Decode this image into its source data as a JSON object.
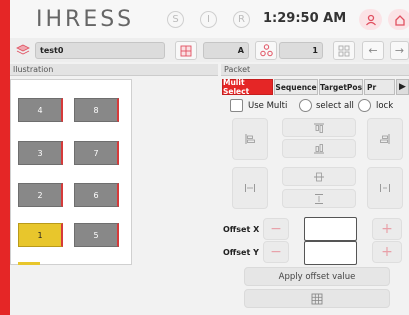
{
  "header": {
    "logo": "IHRESS",
    "buttons": [
      "S",
      "I",
      "R"
    ],
    "time": "1:29:50 AM"
  },
  "toolbar": {
    "project_name": "test0",
    "field_a": "A",
    "field_num": "1",
    "back_icon": "arrow-left-icon",
    "forward_icon": "arrow-right-icon"
  },
  "illustration": {
    "title": "llustration",
    "cells": [
      "4",
      "8",
      "3",
      "7",
      "2",
      "6",
      "1",
      "5"
    ],
    "selected_cell": "1"
  },
  "packet": {
    "title": "Packet",
    "tabs": [
      "Mulit Select",
      "Sequence",
      "TargetPos",
      "Pr"
    ],
    "active_tab": "Mulit Select",
    "use_multi": "Use Multi",
    "select_all": "select all",
    "lock": "lock",
    "offset_x": "Offset X",
    "offset_y": "Offset Y",
    "minus": "−",
    "plus": "+",
    "apply": "Apply offset value"
  },
  "colors": {
    "accent": "#e52626",
    "selected_cell": "#e8c62c",
    "cell": "#888888"
  }
}
